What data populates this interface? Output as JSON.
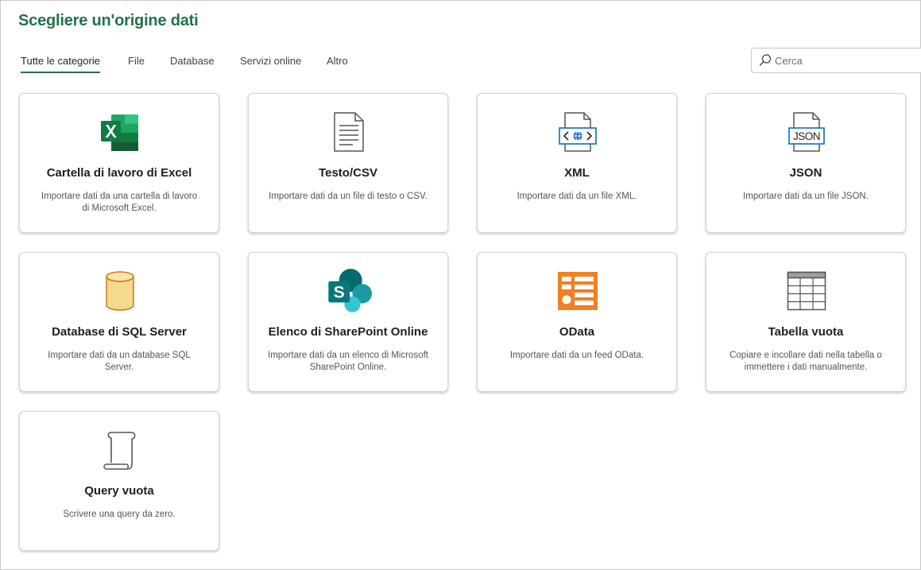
{
  "header": {
    "title": "Scegliere un'origine dati"
  },
  "tabs": [
    {
      "label": "Tutte le categorie",
      "active": true
    },
    {
      "label": "File"
    },
    {
      "label": "Database"
    },
    {
      "label": "Servizi online"
    },
    {
      "label": "Altro"
    }
  ],
  "search": {
    "placeholder": "Cerca",
    "value": ""
  },
  "colors": {
    "accent": "#217346",
    "excel_green": "#1d6f42",
    "xml_blue": "#0f6cbd",
    "sql_gold": "#f5d98f",
    "sharepoint_teal": "#038387",
    "odata_orange": "#f28021"
  },
  "sources": [
    {
      "icon": "excel-icon",
      "title": "Cartella di lavoro di Excel",
      "description": "Importare dati da una cartella di lavoro di Microsoft Excel."
    },
    {
      "icon": "text-file-icon",
      "title": "Testo/CSV",
      "description": "Importare dati da un file di testo o CSV."
    },
    {
      "icon": "xml-file-icon",
      "title": "XML",
      "description": "Importare dati da un file XML."
    },
    {
      "icon": "json-file-icon",
      "title": "JSON",
      "description": "Importare dati da un file JSON."
    },
    {
      "icon": "sql-database-icon",
      "title": "Database di SQL Server",
      "description": "Importare dati da un database SQL Server."
    },
    {
      "icon": "sharepoint-icon",
      "title": "Elenco di SharePoint Online",
      "description": "Importare dati da un elenco di Microsoft SharePoint Online."
    },
    {
      "icon": "odata-icon",
      "title": "OData",
      "description": "Importare dati da un feed OData."
    },
    {
      "icon": "blank-table-icon",
      "title": "Tabella vuota",
      "description": "Copiare e incollare dati nella tabella o immettere i dati manualmente."
    },
    {
      "icon": "blank-query-scroll-icon",
      "title": "Query vuota",
      "description": "Scrivere una query da zero."
    }
  ]
}
